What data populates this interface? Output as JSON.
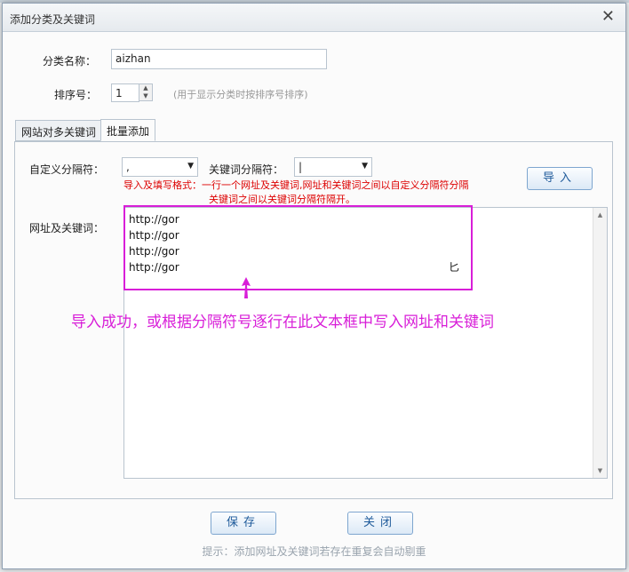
{
  "dialog": {
    "title": "添加分类及关键词",
    "close_glyph": "✕"
  },
  "form": {
    "category_label": "分类名称：",
    "category_value": "aizhan",
    "sort_label": "排序号：",
    "sort_value": "1",
    "sort_hint": "(用于显示分类时按排序号排序)"
  },
  "tabs": [
    {
      "label": "网站对多关键词",
      "active": false
    },
    {
      "label": "批量添加",
      "active": true
    }
  ],
  "batch": {
    "custom_sep_label": "自定义分隔符：",
    "custom_sep_value": ",",
    "keyword_sep_label": "关键词分隔符：",
    "keyword_sep_value": "|",
    "format_note_line1": "导入及填写格式：一行一个网址及关键词,网址和关键词之间以自定义分隔符分隔",
    "format_note_line2": "关键词之间以关键词分隔符隔开。",
    "import_button": "导入",
    "url_kw_label": "网址及关键词：",
    "lines": [
      "http://gor",
      "http://gor",
      "http://gor",
      "http://gor"
    ],
    "trailing_char": "匕"
  },
  "annotation": {
    "text": "导入成功，或根据分隔符号逐行在此文本框中写入网址和关键词",
    "color": "#d81ed8"
  },
  "buttons": {
    "save": "保存",
    "close": "关闭"
  },
  "footer_hint": "提示：添加网址及关键词若存在重复会自动剔重"
}
